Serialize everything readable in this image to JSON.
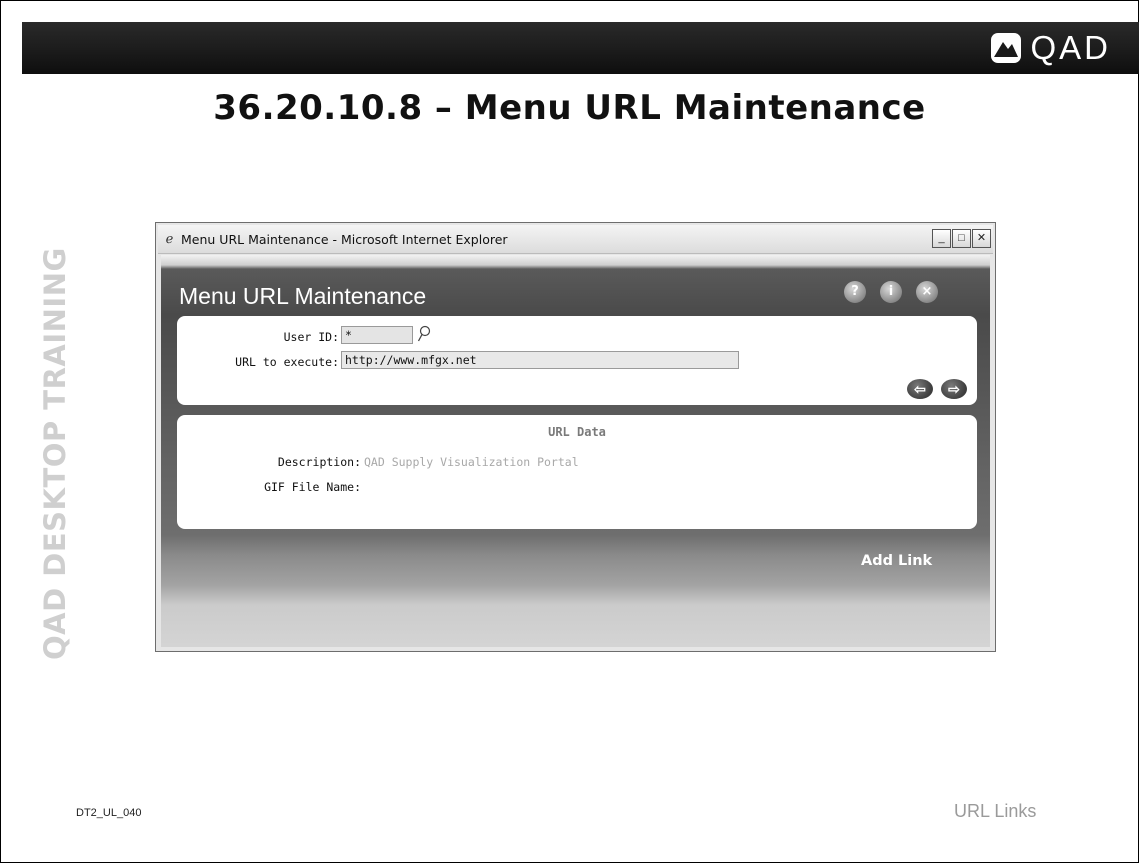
{
  "slide": {
    "title": "36.20.10.8 – Menu URL Maintenance",
    "side_label": "QAD DESKTOP TRAINING",
    "footer_code": "DT2_UL_040",
    "footer_label": "URL Links",
    "logo_text": "QAD"
  },
  "window": {
    "title": "Menu URL Maintenance - Microsoft Internet Explorer",
    "controls": [
      "minimize-icon",
      "maximize-icon",
      "close-icon"
    ]
  },
  "app": {
    "title": "Menu URL Maintenance",
    "buttons": {
      "help": "?",
      "info": "i",
      "close": "×"
    },
    "form": {
      "user_id_label": "User ID:",
      "user_id_value": "*",
      "url_label": "URL to execute:",
      "url_value": "http://www.mfgx.net"
    },
    "nav": {
      "prev": "⇦",
      "next": "⇨"
    },
    "url_data": {
      "section_title": "URL Data",
      "description_label": "Description:",
      "description_value": "QAD Supply Visualization Portal",
      "gif_label": "GIF File Name:",
      "gif_value": ""
    },
    "add_link_label": "Add Link"
  }
}
